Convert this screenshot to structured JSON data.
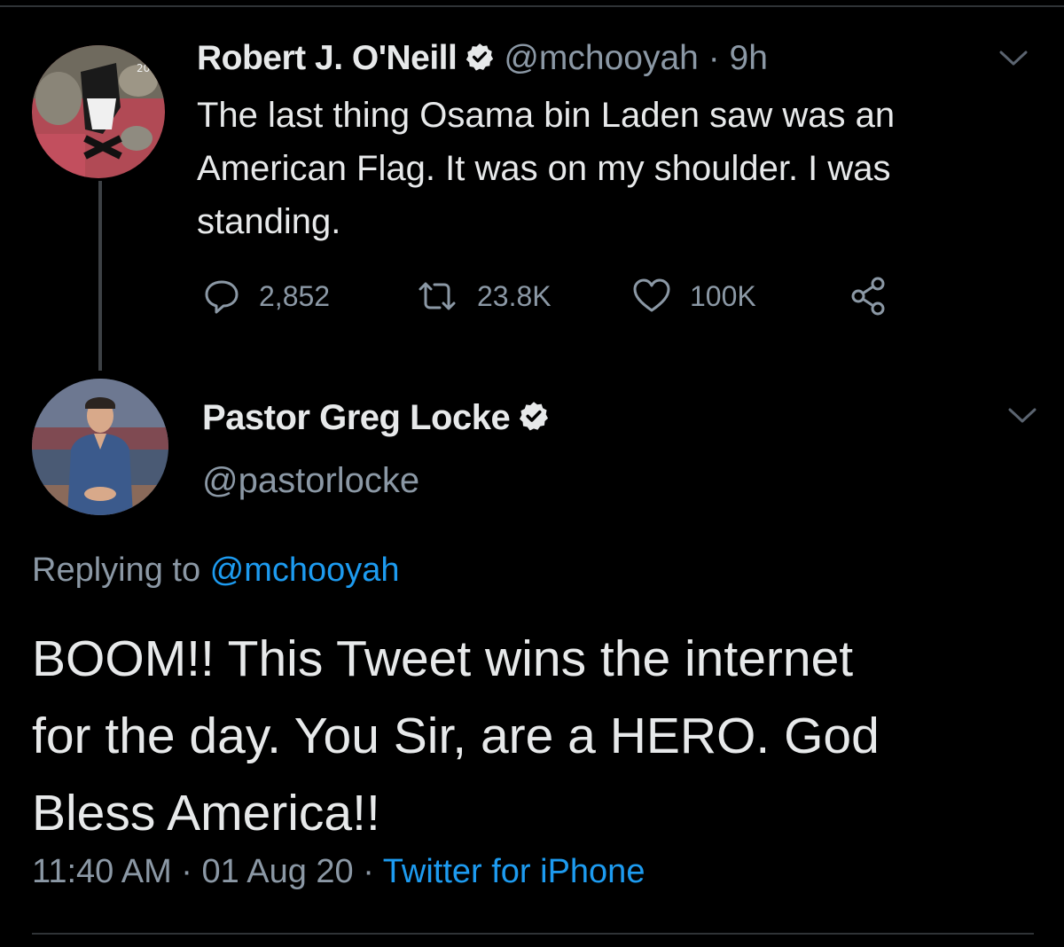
{
  "colors": {
    "background": "#000000",
    "text_primary": "#e7e9ea",
    "text_secondary": "#8b98a5",
    "accent_link": "#1d9bf0",
    "divider": "#2f3336"
  },
  "icons": {
    "verified": "verified-badge-icon",
    "menu": "chevron-down-icon",
    "reply": "reply-bubble-icon",
    "retweet": "retweet-icon",
    "like": "heart-icon",
    "share": "share-icon"
  },
  "parent_tweet": {
    "display_name": "Robert J. O'Neill",
    "handle_time": "@mchooyah · 9h",
    "text": "The last thing Osama bin Laden saw was an\nAmerican Flag. It was on my shoulder. I was\nstanding.",
    "stats": {
      "replies": "2,852",
      "retweets": "23.8K",
      "likes": "100K"
    }
  },
  "reply_tweet": {
    "display_name": "Pastor Greg Locke",
    "handle": "@pastorlocke",
    "replying_prefix": "Replying to ",
    "replying_to": "@mchooyah",
    "text": "BOOM!! This Tweet wins the internet\nfor the day. You Sir, are a HERO. God\nBless America!!",
    "timestamp": "11:40 AM · 01 Aug 20 · ",
    "source": "Twitter for iPhone"
  }
}
